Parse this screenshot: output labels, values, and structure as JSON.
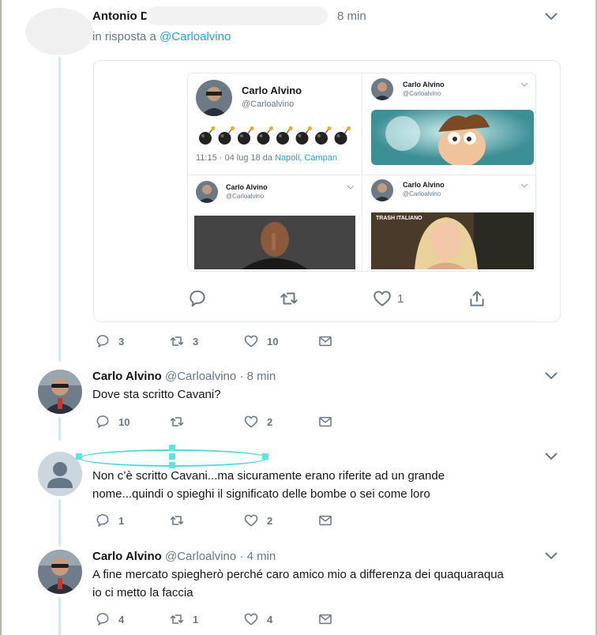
{
  "tweets": [
    {
      "author": "Antonio Di",
      "time": "8 min",
      "reply_prefix": "in risposta a ",
      "reply_handle": "@Carloalvino",
      "actions": {
        "replies": "3",
        "retweets": "3",
        "likes": "10"
      }
    },
    {
      "author": "Carlo Alvino",
      "handle": "@Carloalvino",
      "time": "· 8 min",
      "text": "Dove sta scritto Cavani?",
      "actions": {
        "replies": "10",
        "retweets": "",
        "likes": "2"
      }
    },
    {
      "author": "",
      "text_line1": "Non c’è scritto Cavani...ma sicuramente erano riferite ad un grande",
      "text_line2": "nome...quindi o spieghi il significato delle bombe o sei come loro",
      "actions": {
        "replies": "1",
        "retweets": "",
        "likes": "2"
      }
    },
    {
      "author": "Carlo Alvino",
      "handle": "@Carloalvino",
      "time": "· 4 min",
      "text_line1": "A fine mercato spiegherò perché caro amico mio a differenza dei quaquaraqua",
      "text_line2": "io ci metto la faccia",
      "actions": {
        "replies": "4",
        "retweets": "1",
        "likes": "4"
      }
    }
  ],
  "embedded": {
    "main_name": "Carlo Alvino",
    "main_handle": "@Carloalvino",
    "bombs": "💣💣💣💣💣💣💣💣",
    "bomb_count": 8,
    "timestamp": "11:15 · 04 lug 18 da ",
    "location": "Napoli, Campan",
    "mini_name": "Carlo Alvino",
    "mini_handle": "@Carloalvino",
    "gif_caption": "TRASH ITALIANO",
    "card_likes": "1"
  },
  "colors": {
    "accent": "#1da1f2",
    "muted": "#657786",
    "thread_line": "#cfe8f4",
    "selection": "#4fd8d8"
  },
  "icons": [
    "reply-icon",
    "retweet-icon",
    "like-icon",
    "message-icon",
    "share-icon",
    "chevron-down-icon",
    "default-avatar-icon"
  ]
}
